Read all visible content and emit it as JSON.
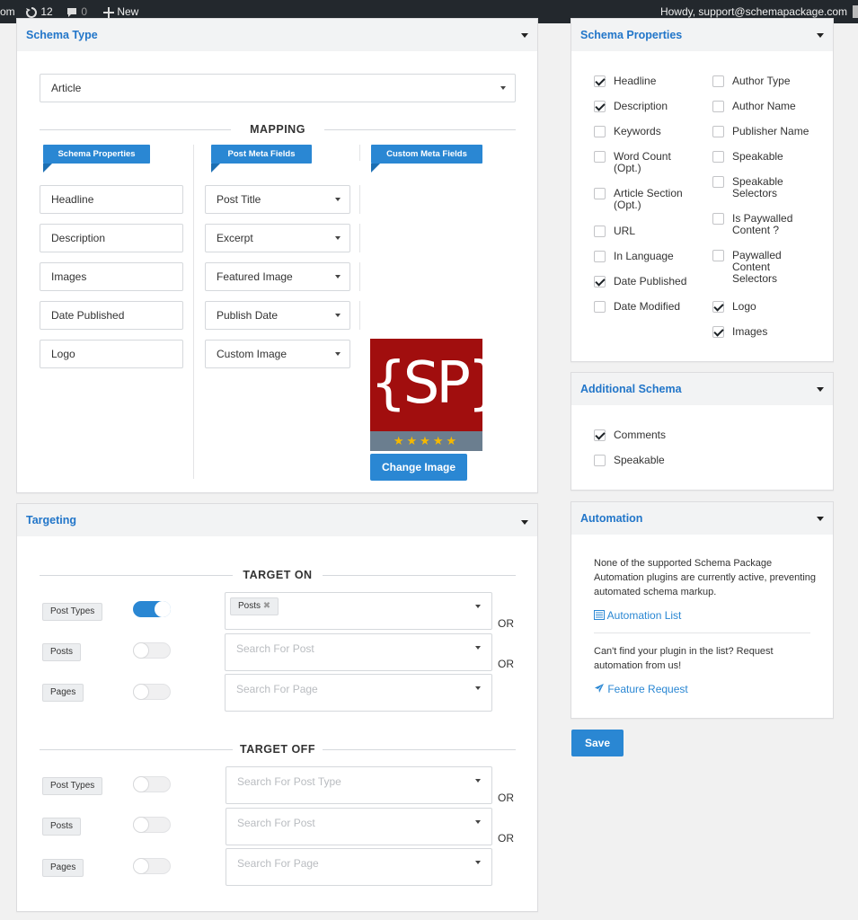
{
  "admin_bar": {
    "site_fragment": "om",
    "updates_count": "12",
    "comments_count": "0",
    "new_label": "New",
    "howdy": "Howdy, support@schemapackage.com"
  },
  "schema_type": {
    "title": "Schema Type",
    "selected": "Article",
    "mapping_title": "MAPPING",
    "col_headers": [
      "Schema Properties",
      "Post Meta Fields",
      "Custom Meta Fields"
    ],
    "rows": [
      {
        "property": "Headline",
        "field": "Post Title"
      },
      {
        "property": "Description",
        "field": "Excerpt"
      },
      {
        "property": "Images",
        "field": "Featured Image"
      },
      {
        "property": "Date Published",
        "field": "Publish Date"
      },
      {
        "property": "Logo",
        "field": "Custom Image"
      }
    ],
    "logo_text": "{SP}",
    "rating_stars": 5,
    "change_image_label": "Change Image"
  },
  "targeting": {
    "title": "Targeting",
    "target_on_title": "TARGET ON",
    "target_off_title": "TARGET OFF",
    "or_label": "OR",
    "on_rows": [
      {
        "label": "Post Types",
        "enabled": true,
        "tag": "Posts",
        "placeholder": ""
      },
      {
        "label": "Posts",
        "enabled": false,
        "placeholder": "Search For Post"
      },
      {
        "label": "Pages",
        "enabled": false,
        "placeholder": "Search For Page"
      }
    ],
    "off_rows": [
      {
        "label": "Post Types",
        "enabled": false,
        "placeholder": "Search For Post Type"
      },
      {
        "label": "Posts",
        "enabled": false,
        "placeholder": "Search For Post"
      },
      {
        "label": "Pages",
        "enabled": false,
        "placeholder": "Search For Page"
      }
    ]
  },
  "schema_properties": {
    "title": "Schema Properties",
    "left": [
      {
        "label": "Headline",
        "checked": true
      },
      {
        "label": "Description",
        "checked": true
      },
      {
        "label": "Keywords",
        "checked": false
      },
      {
        "label": "Word Count\n(Opt.)",
        "checked": false
      },
      {
        "label": "Article Section\n(Opt.)",
        "checked": false
      },
      {
        "label": "URL",
        "checked": false
      },
      {
        "label": "In Language",
        "checked": false
      },
      {
        "label": "Date Published",
        "checked": true
      },
      {
        "label": "Date Modified",
        "checked": false
      }
    ],
    "right": [
      {
        "label": "Author Type",
        "checked": false
      },
      {
        "label": "Author Name",
        "checked": false
      },
      {
        "label": "Publisher Name",
        "checked": false
      },
      {
        "label": "Speakable",
        "checked": false
      },
      {
        "label": "Speakable\nSelectors",
        "checked": false
      },
      {
        "label": "Is Paywalled\nContent ?",
        "checked": false
      },
      {
        "label": "Paywalled\nContent\nSelectors",
        "checked": false
      },
      {
        "label": "Logo",
        "checked": true
      },
      {
        "label": "Images",
        "checked": true
      }
    ]
  },
  "additional_schema": {
    "title": "Additional Schema",
    "items": [
      {
        "label": "Comments",
        "checked": true
      },
      {
        "label": "Speakable",
        "checked": false
      }
    ]
  },
  "automation": {
    "title": "Automation",
    "notice": "None of the supported Schema Package Automation plugins are currently active, preventing automated schema markup.",
    "list_link": "Automation List",
    "request_text": "Can't find your plugin in the list? Request automation from us!",
    "feature_link": "Feature Request"
  },
  "save_label": "Save",
  "colors": {
    "accent": "#2a87d3",
    "admin_bar": "#23282d",
    "logo_bg": "#a10e0e",
    "star": "#f5b800"
  }
}
